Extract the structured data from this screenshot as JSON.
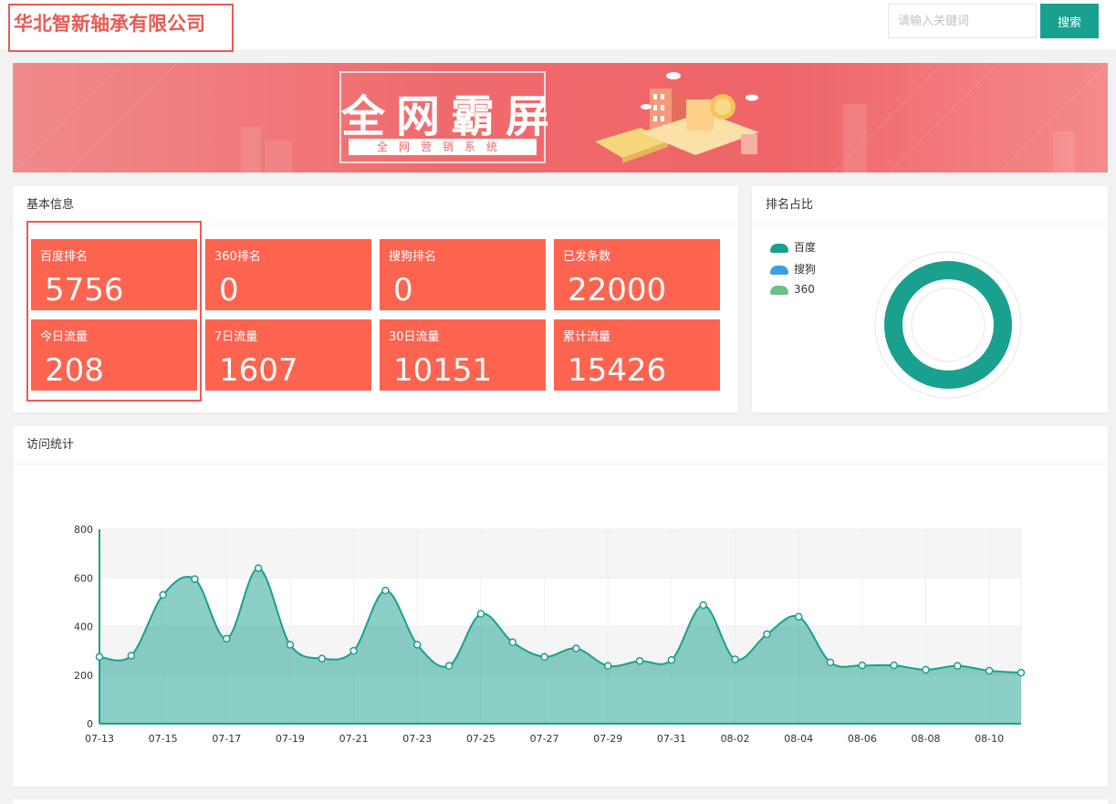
{
  "header": {
    "company_name": "华北智新轴承有限公司",
    "search_placeholder": "请输入关键词",
    "search_label": "搜索"
  },
  "banner": {
    "title": "全网霸屏",
    "subtitle": "全网营销系统"
  },
  "basic_info": {
    "title": "基本信息",
    "tiles": [
      {
        "label": "百度排名",
        "value": "5756"
      },
      {
        "label": "360排名",
        "value": "0"
      },
      {
        "label": "搜狗排名",
        "value": "0"
      },
      {
        "label": "已发条数",
        "value": "22000"
      },
      {
        "label": "今日流量",
        "value": "208"
      },
      {
        "label": "7日流量",
        "value": "1607"
      },
      {
        "label": "30日流量",
        "value": "10151"
      },
      {
        "label": "累计流量",
        "value": "15426"
      }
    ]
  },
  "rank_share": {
    "title": "排名占比",
    "legend": [
      {
        "name": "百度",
        "color": "#19a08e"
      },
      {
        "name": "搜狗",
        "color": "#3ca0e6"
      },
      {
        "name": "360",
        "color": "#6cc08a"
      }
    ],
    "values": [
      5756,
      0,
      0
    ]
  },
  "visits": {
    "title": "访问统计"
  },
  "colors": {
    "accent": "#19a08e",
    "tile": "#fd6450",
    "brand": "#ec5a54"
  },
  "chart_data": {
    "type": "area",
    "title": "",
    "xlabel": "",
    "ylabel": "",
    "ylim": [
      0,
      800
    ],
    "yticks": [
      0,
      200,
      400,
      600,
      800
    ],
    "x": [
      "07-13",
      "07-14",
      "07-15",
      "07-16",
      "07-17",
      "07-18",
      "07-19",
      "07-20",
      "07-21",
      "07-22",
      "07-23",
      "07-24",
      "07-25",
      "07-26",
      "07-27",
      "07-28",
      "07-29",
      "07-30",
      "07-31",
      "08-01",
      "08-02",
      "08-03",
      "08-04",
      "08-05",
      "08-06",
      "08-07",
      "08-08",
      "08-09",
      "08-10",
      "08-11"
    ],
    "xtick_labels": [
      "07-13",
      "07-15",
      "07-17",
      "07-19",
      "07-21",
      "07-23",
      "07-25",
      "07-27",
      "07-29",
      "07-31",
      "08-02",
      "08-04",
      "08-06",
      "08-08",
      "08-10"
    ],
    "series": [
      {
        "values": [
          275,
          280,
          530,
          595,
          350,
          640,
          325,
          268,
          300,
          548,
          325,
          238,
          452,
          335,
          275,
          310,
          238,
          258,
          262,
          488,
          265,
          368,
          440,
          252,
          240,
          240,
          222,
          238,
          218,
          210
        ]
      }
    ],
    "grid": true
  }
}
